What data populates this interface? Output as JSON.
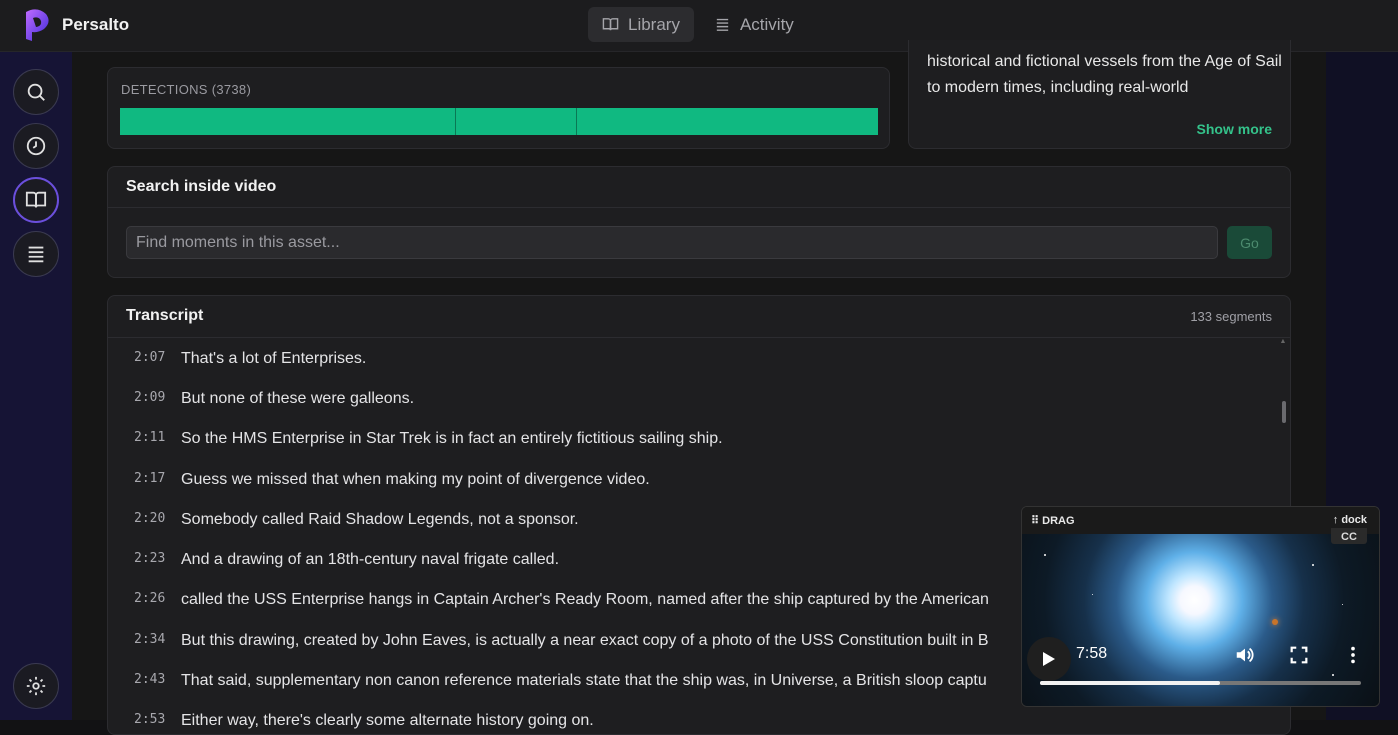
{
  "app": {
    "name": "Persalto"
  },
  "nav": {
    "tabs": [
      {
        "label": "Library",
        "active": true
      },
      {
        "label": "Activity",
        "active": false
      }
    ]
  },
  "sidebar": {
    "items": [
      "search-icon",
      "history-icon",
      "library-icon",
      "list-icon"
    ],
    "settings": "gear-icon"
  },
  "detections": {
    "label": "DETECTIONS (3738)",
    "bar_color": "#10b981"
  },
  "description": {
    "text": "historical and fictional vessels from the Age of Sail to modern times, including real-world",
    "show_more": "Show more"
  },
  "search": {
    "title": "Search inside video",
    "placeholder": "Find moments in this asset...",
    "go_label": "Go"
  },
  "transcript": {
    "title": "Transcript",
    "count": "133 segments",
    "segments": [
      {
        "time": "2:07",
        "text": "That's a lot of Enterprises."
      },
      {
        "time": "2:09",
        "text": "But none of these were galleons."
      },
      {
        "time": "2:11",
        "text": "So the HMS Enterprise in Star Trek is in fact an entirely fictitious sailing ship."
      },
      {
        "time": "2:17",
        "text": "Guess we missed that when making my point of divergence video."
      },
      {
        "time": "2:20",
        "text": "Somebody called Raid Shadow Legends, not a sponsor."
      },
      {
        "time": "2:23",
        "text": "And a drawing of an 18th-century naval frigate called."
      },
      {
        "time": "2:26",
        "text": "called the USS Enterprise hangs in Captain Archer's Ready Room, named after the ship captured by the American"
      },
      {
        "time": "2:34",
        "text": "But this drawing, created by John Eaves, is actually a near exact copy of a photo of the USS Constitution built in B"
      },
      {
        "time": "2:43",
        "text": "That said, supplementary non canon reference materials state that the ship was, in Universe, a British sloop captu"
      },
      {
        "time": "2:53",
        "text": "Either way, there's clearly some alternate history going on."
      }
    ]
  },
  "player": {
    "drag_label": "DRAG",
    "dock_label": "dock",
    "cc_label": "CC",
    "time": "7:58",
    "progress": 0.56
  }
}
